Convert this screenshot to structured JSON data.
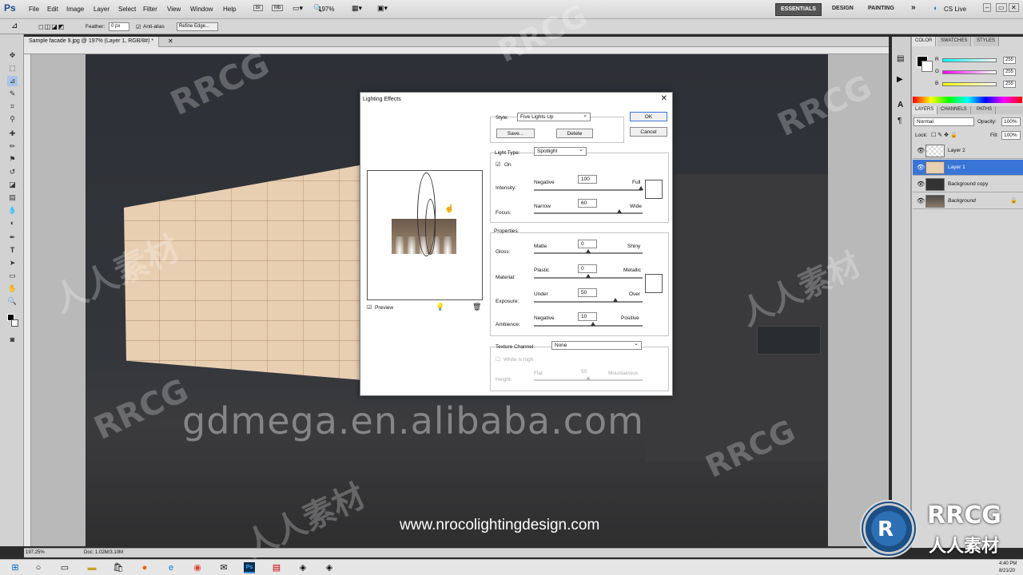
{
  "app": {
    "logo": "Ps",
    "menus": [
      "File",
      "Edit",
      "Image",
      "Layer",
      "Select",
      "Filter",
      "View",
      "Window",
      "Help"
    ],
    "zoom": "197%",
    "workspaces": [
      "ESSENTIALS",
      "DESIGN",
      "PAINTING"
    ],
    "cs_live": "CS Live",
    "more": "»"
  },
  "options_bar": {
    "feather_label": "Feather:",
    "feather_value": "0 px",
    "anti_alias": "Anti-alias",
    "refine_edge": "Refine Edge..."
  },
  "document": {
    "tab_title": "Sample facade 9.jpg @ 197% (Layer 1, RGB/8#) *",
    "status_zoom": "197.25%",
    "status_doc": "Doc: 1.02M/3.10M"
  },
  "color_panel": {
    "tabs": [
      "COLOR",
      "SWATCHES",
      "STYLES"
    ],
    "channels": [
      {
        "label": "R",
        "value": "255"
      },
      {
        "label": "G",
        "value": "255"
      },
      {
        "label": "B",
        "value": "255"
      }
    ]
  },
  "layers_panel": {
    "tabs": [
      "LAYERS",
      "CHANNELS",
      "PATHS"
    ],
    "blend_mode": "Normal",
    "opacity_label": "Opacity:",
    "opacity": "100%",
    "lock_label": "Lock:",
    "fill_label": "Fill:",
    "fill": "100%",
    "layers": [
      {
        "name": "Layer 2",
        "selected": false
      },
      {
        "name": "Layer 1",
        "selected": true
      },
      {
        "name": "Background copy",
        "selected": false
      },
      {
        "name": "Background",
        "selected": false
      }
    ]
  },
  "dialog": {
    "title": "Lighting Effects",
    "ok": "OK",
    "cancel": "Cancel",
    "preview_label": "Preview",
    "style_label": "Style:",
    "style_value": "Five Lights Up",
    "save": "Save...",
    "delete": "Delete",
    "light_type_label": "Light Type:",
    "light_type_value": "Spotlight",
    "on_label": "On",
    "intensity_label": "Intensity:",
    "intensity_min": "Negative",
    "intensity_max": "Full",
    "intensity_value": "100",
    "focus_label": "Focus:",
    "focus_min": "Narrow",
    "focus_max": "Wide",
    "focus_value": "60",
    "properties_label": "Properties:",
    "gloss_label": "Gloss:",
    "gloss_min": "Matte",
    "gloss_max": "Shiny",
    "gloss_value": "0",
    "material_label": "Material:",
    "material_min": "Plastic",
    "material_max": "Metallic",
    "material_value": "0",
    "exposure_label": "Exposure:",
    "exposure_min": "Under",
    "exposure_max": "Over",
    "exposure_value": "50",
    "ambience_label": "Ambience:",
    "ambience_min": "Negative",
    "ambience_max": "Positive",
    "ambience_value": "10",
    "texture_label": "Texture Channel:",
    "texture_value": "None",
    "white_is_high": "White is high",
    "height_label": "Height:",
    "height_min": "Flat",
    "height_max": "Mountainous",
    "height_value": "50"
  },
  "overlays": {
    "watermark_url": "gdmega.en.alibaba.com",
    "caption": "www.nrocolightingdesign.com",
    "watermark_text": "RRCG",
    "watermark_cn": "人人素材",
    "logo_text": "RRCG",
    "logo_cn": "人人素材"
  },
  "taskbar": {
    "time": "4:40 PM",
    "date": "8/21/20"
  }
}
